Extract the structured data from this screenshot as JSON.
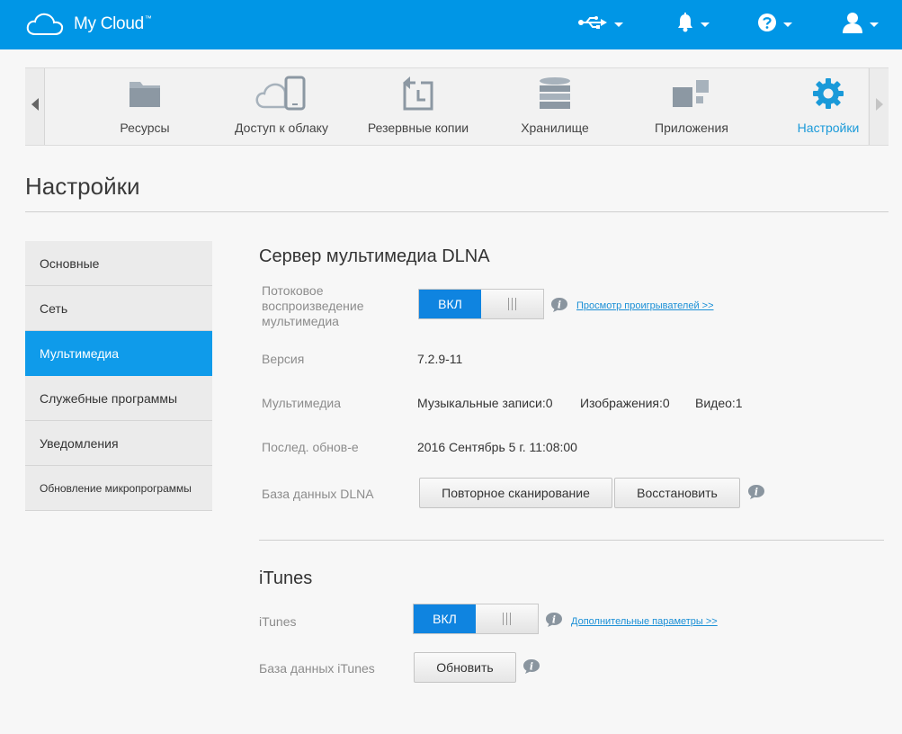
{
  "header": {
    "brand": "My Cloud",
    "trademark": "™",
    "icons": [
      "cloud-logo-icon",
      "usb-icon",
      "bell-icon",
      "help-icon",
      "user-icon"
    ]
  },
  "nav": {
    "items": [
      {
        "label": "Ресурсы",
        "icon": "folder-icon"
      },
      {
        "label": "Доступ к облаку",
        "icon": "cloud-device-icon"
      },
      {
        "label": "Резервные копии",
        "icon": "backup-icon"
      },
      {
        "label": "Хранилище",
        "icon": "storage-icon"
      },
      {
        "label": "Приложения",
        "icon": "apps-icon"
      },
      {
        "label": "Настройки",
        "icon": "gear-icon",
        "active": true
      }
    ]
  },
  "page": {
    "title": "Настройки"
  },
  "sidebar": {
    "items": [
      {
        "label": "Основные"
      },
      {
        "label": "Сеть"
      },
      {
        "label": "Мультимедиа",
        "active": true
      },
      {
        "label": "Служебные программы"
      },
      {
        "label": "Уведомления"
      },
      {
        "label": "Обновление микропрограммы"
      }
    ]
  },
  "dlna": {
    "title": "Сервер мультимедиа DLNA",
    "streaming_label_1": "Потоковое",
    "streaming_label_2": "воспроизведение",
    "streaming_label_3": "мультимедиа",
    "toggle_on": "ВКЛ",
    "players_link": "Просмотр проигрывателей >>",
    "version_label": "Версия",
    "version_value": "7.2.9-11",
    "media_label": "Мультимедиа",
    "music": "Музыкальные записи:0",
    "images": "Изображения:0",
    "video": "Видео:1",
    "last_update_label": "Послед. обнов-е",
    "last_update_value": "2016 Сентябрь 5 г. 11:08:00",
    "db_label": "База данных DLNA",
    "rescan_button": "Повторное сканирование",
    "restore_button": "Восстановить"
  },
  "itunes": {
    "title": "iTunes",
    "toggle_label": "iTunes",
    "toggle_on": "ВКЛ",
    "advanced_link": "Дополнительные параметры >>",
    "db_label": "База данных iTunes",
    "refresh_button": "Обновить"
  },
  "colors": {
    "header": "#0096e6",
    "accent": "#0f9bea",
    "toggle_on": "#0f84e0"
  }
}
